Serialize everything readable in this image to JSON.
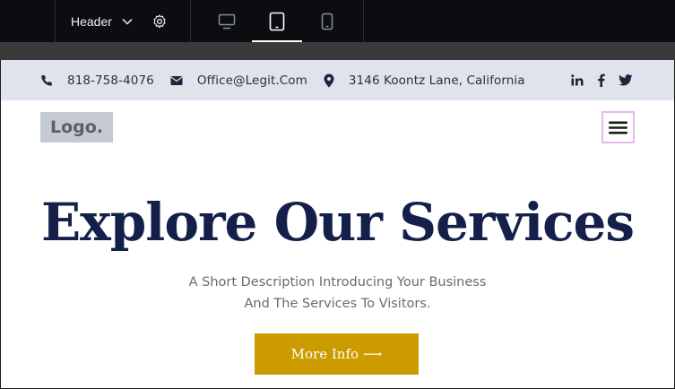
{
  "toolbar": {
    "header_label": "Header",
    "icons": [
      "chevron-down-icon",
      "gear-icon",
      "desktop-icon",
      "tablet-icon",
      "mobile-icon"
    ],
    "active_device": "tablet"
  },
  "topbar": {
    "phone": "818-758-4076",
    "email": "Office@Legit.Com",
    "address": "3146 Koontz Lane, California",
    "social_icons": [
      "linkedin-icon",
      "facebook-icon",
      "twitter-icon"
    ]
  },
  "header": {
    "logo_text": "Logo."
  },
  "hero": {
    "title": "Explore Our Services",
    "description_line1": "A Short Description Introducing Your Business",
    "description_line2": "And The Services To Visitors.",
    "cta_label": "More Info ⟶"
  },
  "colors": {
    "toolbar_bg": "#0b0d11",
    "topbar_bg": "#dfe3ec",
    "title": "#14204a",
    "cta_bg": "#cc9b00",
    "menu_outline": "#e6b8ef"
  }
}
